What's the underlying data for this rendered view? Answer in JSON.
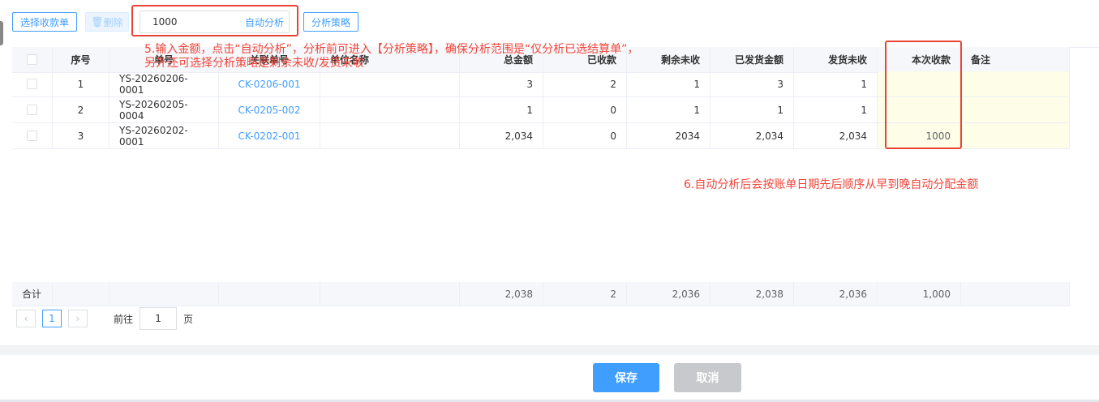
{
  "toolbar": {
    "select_label": "选择收款单",
    "delete_label": "删除",
    "amount_value": "1000",
    "auto_label": "自动分析",
    "strategy_label": "分析策略"
  },
  "annotations": {
    "note5_line1": "5.输入金额，点击“自动分析”，分析前可进入【分析策略】，确保分析范围是“仅分析已选结算单”，",
    "note5_line2": "另外还可选择分析策略是剩余未收/发货未收",
    "note6": "6.自动分析后会按账单日期先后顺序从早到晚自动分配金额"
  },
  "table": {
    "headers": [
      "序号",
      "单号",
      "关联单号",
      "单位名称",
      "总金额",
      "已收款",
      "剩余未收",
      "已发货金额",
      "发货未收",
      "本次收款",
      "备注"
    ],
    "rows": [
      [
        "1",
        "YS-20260206-0001",
        "CK-0206-001",
        "",
        "3",
        "2",
        "1",
        "3",
        "1",
        "",
        ""
      ],
      [
        "2",
        "YS-20260205-0004",
        "CK-0205-002",
        "",
        "1",
        "0",
        "1",
        "1",
        "1",
        "",
        ""
      ],
      [
        "3",
        "YS-20260202-0001",
        "CK-0202-001",
        "",
        "2,034",
        "0",
        "2034",
        "2,034",
        "2,034",
        "1000",
        ""
      ]
    ],
    "footer": {
      "label": "合计",
      "values": [
        "2,038",
        "2",
        "2,036",
        "2,038",
        "2,036",
        "1,000"
      ]
    }
  },
  "pager": {
    "current": "1",
    "goto_label": "前往",
    "goto_value": "1",
    "page_suffix": "页"
  },
  "actions": {
    "save": "保存",
    "cancel": "取消"
  },
  "colors": {
    "accent": "#409eff",
    "annotation": "#f0453a"
  }
}
